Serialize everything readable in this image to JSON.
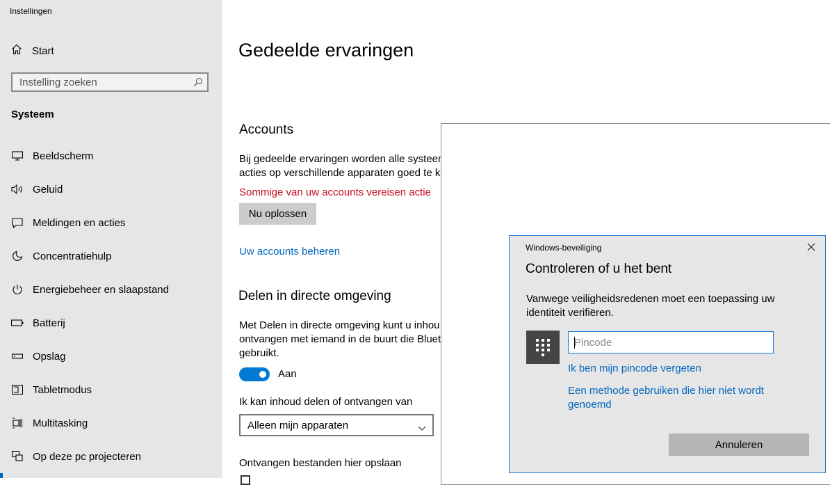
{
  "app": {
    "title": "Instellingen"
  },
  "sidebar": {
    "home_label": "Start",
    "search_placeholder": "Instelling zoeken",
    "section": "Systeem",
    "items": [
      {
        "label": "Beeldscherm",
        "icon": "monitor-icon"
      },
      {
        "label": "Geluid",
        "icon": "speaker-icon"
      },
      {
        "label": "Meldingen en acties",
        "icon": "notification-icon"
      },
      {
        "label": "Concentratiehulp",
        "icon": "moon-icon"
      },
      {
        "label": "Energiebeheer en slaapstand",
        "icon": "power-icon"
      },
      {
        "label": "Batterij",
        "icon": "battery-icon"
      },
      {
        "label": "Opslag",
        "icon": "storage-icon"
      },
      {
        "label": "Tabletmodus",
        "icon": "tablet-icon"
      },
      {
        "label": "Multitasking",
        "icon": "multitasking-icon"
      },
      {
        "label": "Op deze pc projecteren",
        "icon": "project-icon"
      }
    ]
  },
  "main": {
    "title": "Gedeelde ervaringen",
    "accounts": {
      "heading": "Accounts",
      "description": "Bij gedeelde ervaringen worden alle systeem acties op verschillende apparaten goed te ke",
      "warning": "Sommige van uw accounts vereisen actie",
      "fix_button": "Nu oplossen",
      "manage_link": "Uw accounts beheren"
    },
    "nearby": {
      "heading": "Delen in directe omgeving",
      "description": "Met Delen in directe omgeving kunt u inhou ontvangen met iemand in de buurt die Bluet gebruikt.",
      "toggle_label": "Aan",
      "toggle_on": true,
      "share_from_label": "Ik kan inhoud delen of ontvangen van",
      "share_from_value": "Alleen mijn apparaten",
      "save_label": "Ontvangen bestanden hier opslaan"
    }
  },
  "dialog": {
    "caption": "Windows-beveiliging",
    "title": "Controleren of u het bent",
    "text": "Vanwege veiligheidsredenen moet een toepassing uw identiteit verifiëren.",
    "pin_placeholder": "Pincode",
    "forgot_link": "Ik ben mijn pincode vergeten",
    "other_method_link": "Een methode gebruiken die hier niet wordt genoemd",
    "cancel_button": "Annuleren"
  },
  "colors": {
    "accent": "#0078d4",
    "link": "#0067c0",
    "warning": "#c50f1f",
    "sidebar_bg": "#e6e6e6"
  }
}
